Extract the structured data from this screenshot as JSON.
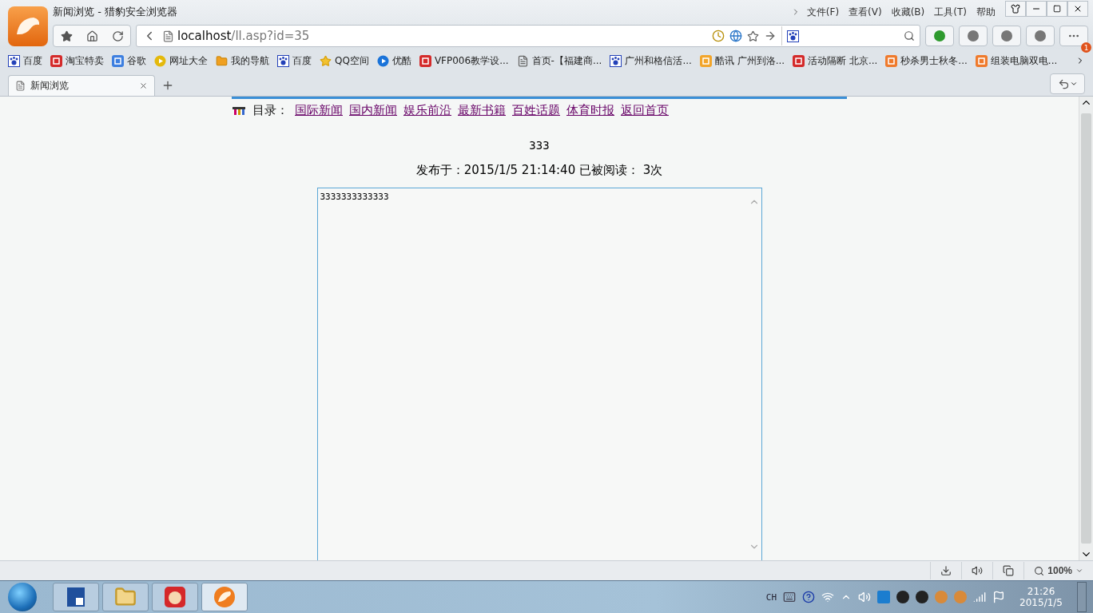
{
  "window": {
    "title": "新闻浏览 - 猎豹安全浏览器"
  },
  "menu": [
    "文件(F)",
    "查看(V)",
    "收藏(B)",
    "工具(T)",
    "帮助"
  ],
  "address": {
    "host": "localhost",
    "path": "/ll.asp?id=35"
  },
  "notification_badge": "1",
  "bookmarks": [
    {
      "label": "百度",
      "kind": "paw"
    },
    {
      "label": "淘宝特卖",
      "kind": "red"
    },
    {
      "label": "谷歌",
      "kind": "blue"
    },
    {
      "label": "网址大全",
      "kind": "plus"
    },
    {
      "label": "我的导航",
      "kind": "folder"
    },
    {
      "label": "百度",
      "kind": "paw"
    },
    {
      "label": "QQ空间",
      "kind": "star"
    },
    {
      "label": "优酷",
      "kind": "play"
    },
    {
      "label": "VFP006教学设...",
      "kind": "red"
    },
    {
      "label": "首页-【福建商...",
      "kind": "page"
    },
    {
      "label": "广州和格信活...",
      "kind": "paw"
    },
    {
      "label": "酷讯 广州到洛...",
      "kind": "bird"
    },
    {
      "label": "活动隔断 北京...",
      "kind": "red"
    },
    {
      "label": "秒杀男士秋冬...",
      "kind": "orange"
    },
    {
      "label": "组装电脑双电...",
      "kind": "orange"
    }
  ],
  "tabs": [
    {
      "label": "新闻浏览",
      "selected": true
    }
  ],
  "page": {
    "nav_label": "目录：",
    "nav_links": [
      "国际新闻",
      "国内新闻",
      "娱乐前沿",
      "最新书籍",
      "百姓话题",
      "体育时报",
      "返回首页"
    ],
    "article_title": "333",
    "meta": "发布于：2015/1/5 21:14:40 已被阅读： 3次",
    "body": "3333333333333"
  },
  "status_bar": {
    "zoom": "100%"
  },
  "taskbar": {
    "language": "CH",
    "time": "21:26",
    "date": "2015/1/5"
  }
}
